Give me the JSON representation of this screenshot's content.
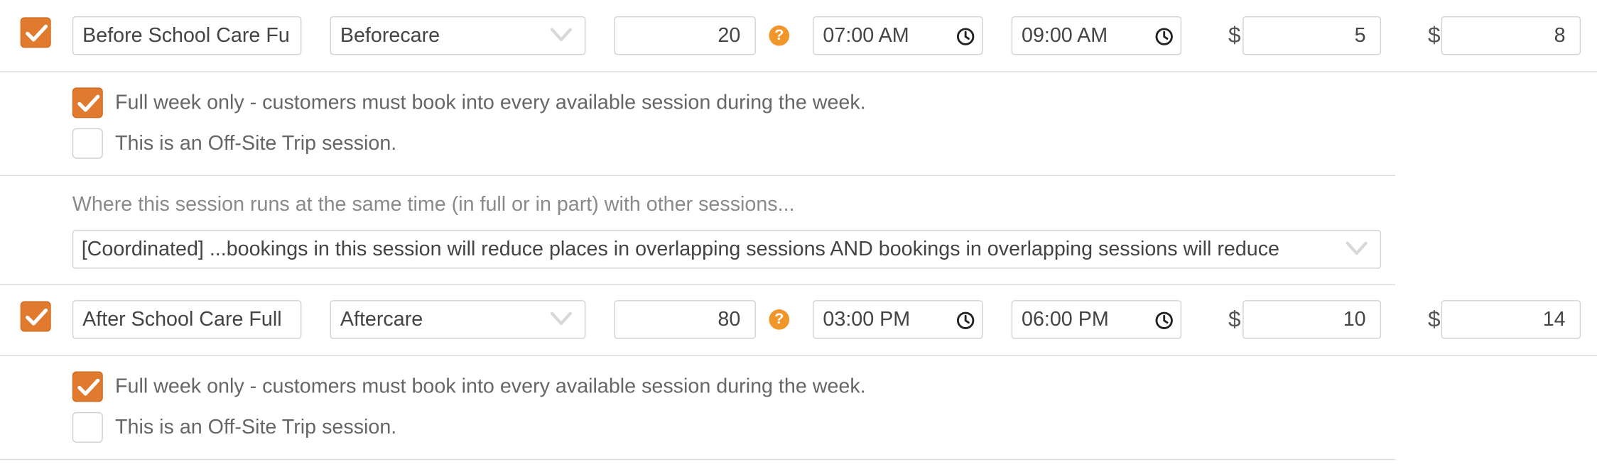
{
  "rows": [
    {
      "enabled": true,
      "name": "Before School Care Fu",
      "category": "Beforecare",
      "capacity": "20",
      "start_time": "07:00 AM",
      "end_time": "09:00 AM",
      "currency_1": "$",
      "price_1": "5",
      "currency_2": "$",
      "price_2": "8",
      "full_week": {
        "checked": true,
        "label": "Full week only - customers must book into every available session during the week."
      },
      "offsite": {
        "checked": false,
        "label": "This is an Off-Site Trip session."
      },
      "overlap_heading": "Where this session runs at the same time (in full or in part) with other sessions...",
      "overlap_selected": "[Coordinated] ...bookings in this session will reduce places in overlapping sessions AND bookings in overlapping sessions will reduce"
    },
    {
      "enabled": true,
      "name": "After School Care Full",
      "category": "Aftercare",
      "capacity": "80",
      "start_time": "03:00 PM",
      "end_time": "06:00 PM",
      "currency_1": "$",
      "price_1": "10",
      "currency_2": "$",
      "price_2": "14",
      "full_week": {
        "checked": true,
        "label": "Full week only - customers must book into every available session during the week."
      },
      "offsite": {
        "checked": false,
        "label": "This is an Off-Site Trip session."
      }
    }
  ],
  "help_glyph": "?",
  "colors": {
    "accent": "#e07a2e",
    "help": "#f0962a",
    "border": "#d3d3d3"
  },
  "icons": [
    "check-icon",
    "chevron-down-icon",
    "clock-icon",
    "help-icon"
  ]
}
